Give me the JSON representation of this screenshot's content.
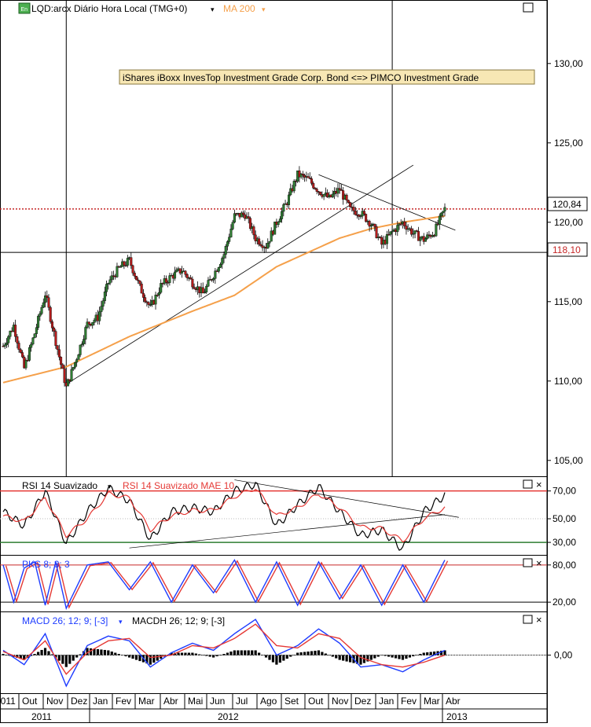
{
  "header": {
    "symbol_label": "LQD:arcx Diário Hora Local (TMG+0)",
    "ma_label": "MA 200",
    "annotation": "iShares iBoxx InvesTop Investment Grade Corp. Bond  <=> PIMCO Investment Grade",
    "price_tag_last": "120,84",
    "price_tag_line": "118,10"
  },
  "panels": {
    "rsi": {
      "label": "RSI 14 Suavizado",
      "label2": "RSI 14 Suavizado MAE 10"
    },
    "pks": {
      "label": "PKS 8; 3; 3"
    },
    "macd": {
      "label": "MACD 26; 12; 9; [-3]",
      "label2": "MACDH 26; 12; 9; [-3]"
    }
  },
  "colors": {
    "price_up": "#2e7d32",
    "price_down": "#b71c1c",
    "ma": "#f5a04a",
    "rsi_line": "#000000",
    "rsi_signal": "#e53935",
    "overbought": "#e53935",
    "oversold": "#2e7d32",
    "pks_fast": "#1e3cff",
    "pks_slow": "#e53935",
    "macd": "#1e3cff",
    "signal": "#e53935",
    "hist": "#000000",
    "tag_bg": "#ffffff"
  },
  "chart_data": [
    {
      "type": "candlestick",
      "title": "LQD:arcx Diário Hora Local (TMG+0)",
      "ylim": [
        104,
        134
      ],
      "y_ticks": [
        "130,00",
        "125,00",
        "120,00",
        "115,00",
        "110,00",
        "105,00"
      ],
      "x_ticks": [
        "2011",
        "Out",
        "Nov",
        "Dez",
        "Jan",
        "Fev",
        "Mar",
        "Abr",
        "Mai",
        "Jun",
        "Jul",
        "Ago",
        "Set",
        "Out",
        "Nov",
        "Dez",
        "Jan",
        "Fev",
        "Mar",
        "Abr"
      ],
      "year_labels": [
        "2011",
        "2012",
        "2013"
      ],
      "close_path": [
        [
          0,
          112.2
        ],
        [
          3,
          113.5
        ],
        [
          6,
          110.8
        ],
        [
          9,
          113.0
        ],
        [
          12,
          115.5
        ],
        [
          15,
          112.5
        ],
        [
          18,
          109.6
        ],
        [
          21,
          111.5
        ],
        [
          24,
          113.6
        ],
        [
          27,
          114.0
        ],
        [
          30,
          116.2
        ],
        [
          33,
          117.1
        ],
        [
          36,
          117.6
        ],
        [
          39,
          115.9
        ],
        [
          42,
          114.6
        ],
        [
          45,
          116.0
        ],
        [
          48,
          116.6
        ],
        [
          51,
          117.0
        ],
        [
          54,
          116.2
        ],
        [
          57,
          115.5
        ],
        [
          60,
          116.7
        ],
        [
          63,
          118.0
        ],
        [
          66,
          120.4
        ],
        [
          69,
          120.5
        ],
        [
          72,
          119.0
        ],
        [
          75,
          118.5
        ],
        [
          78,
          120.0
        ],
        [
          81,
          121.3
        ],
        [
          84,
          123.0
        ],
        [
          87,
          122.7
        ],
        [
          90,
          122.0
        ],
        [
          93,
          121.5
        ],
        [
          96,
          122.1
        ],
        [
          99,
          120.8
        ],
        [
          102,
          120.6
        ],
        [
          105,
          119.9
        ],
        [
          108,
          118.6
        ],
        [
          111,
          119.4
        ],
        [
          114,
          120.0
        ],
        [
          117,
          119.3
        ],
        [
          120,
          118.9
        ],
        [
          123,
          119.4
        ],
        [
          126,
          120.84
        ]
      ],
      "ma200_path": [
        [
          0,
          109.9
        ],
        [
          18,
          110.9
        ],
        [
          36,
          112.8
        ],
        [
          54,
          114.4
        ],
        [
          66,
          115.4
        ],
        [
          78,
          117.2
        ],
        [
          96,
          119.0
        ],
        [
          105,
          119.6
        ],
        [
          114,
          120.0
        ],
        [
          126,
          120.4
        ]
      ],
      "horizontal_levels": [
        120.84,
        118.1
      ],
      "trendlines": [
        {
          "from": [
            18,
            109.8
          ],
          "to": [
            117,
            123.6
          ]
        },
        {
          "from": [
            90,
            123.0
          ],
          "to": [
            129,
            119.5
          ]
        }
      ],
      "vertical_markers": [
        18,
        111
      ]
    },
    {
      "type": "line",
      "title": "RSI 14 Suavizado",
      "ylim": [
        24,
        80
      ],
      "y_ticks": [
        "70,00",
        "50,00",
        "30,00"
      ],
      "levels": {
        "overbought": 70,
        "mid": 50,
        "oversold": 33
      },
      "series": [
        {
          "name": "RSI 14 Suavizado",
          "values": [
            [
              0,
              55
            ],
            [
              6,
              45
            ],
            [
              12,
              70
            ],
            [
              18,
              32
            ],
            [
              24,
              55
            ],
            [
              30,
              72
            ],
            [
              36,
              63
            ],
            [
              42,
              35
            ],
            [
              48,
              55
            ],
            [
              54,
              58
            ],
            [
              60,
              55
            ],
            [
              66,
              70
            ],
            [
              72,
              75
            ],
            [
              78,
              45
            ],
            [
              84,
              60
            ],
            [
              90,
              73
            ],
            [
              96,
              55
            ],
            [
              102,
              38
            ],
            [
              108,
              42
            ],
            [
              114,
              28
            ],
            [
              120,
              55
            ],
            [
              126,
              67
            ]
          ]
        },
        {
          "name": "RSI 14 Suavizado MAE 10",
          "values": [
            [
              0,
              52
            ],
            [
              6,
              48
            ],
            [
              12,
              65
            ],
            [
              18,
              38
            ],
            [
              24,
              50
            ],
            [
              30,
              68
            ],
            [
              36,
              65
            ],
            [
              42,
              42
            ],
            [
              48,
              52
            ],
            [
              54,
              56
            ],
            [
              60,
              56
            ],
            [
              66,
              66
            ],
            [
              72,
              72
            ],
            [
              78,
              52
            ],
            [
              84,
              58
            ],
            [
              90,
              68
            ],
            [
              96,
              58
            ],
            [
              102,
              44
            ],
            [
              108,
              43
            ],
            [
              114,
              34
            ],
            [
              120,
              50
            ],
            [
              126,
              58
            ]
          ]
        }
      ]
    },
    {
      "type": "line",
      "title": "PKS 8; 3; 3",
      "ylim": [
        5,
        95
      ],
      "y_ticks": [
        "80,00",
        "20,00"
      ],
      "series": [
        {
          "name": "PKS 8; 3; 3",
          "values": [
            [
              0,
              80
            ],
            [
              3,
              20
            ],
            [
              6,
              75
            ],
            [
              9,
              85
            ],
            [
              12,
              15
            ],
            [
              15,
              85
            ],
            [
              18,
              10
            ],
            [
              24,
              80
            ],
            [
              30,
              85
            ],
            [
              36,
              40
            ],
            [
              42,
              85
            ],
            [
              48,
              20
            ],
            [
              54,
              80
            ],
            [
              60,
              35
            ],
            [
              66,
              88
            ],
            [
              72,
              20
            ],
            [
              78,
              85
            ],
            [
              84,
              15
            ],
            [
              90,
              85
            ],
            [
              96,
              25
            ],
            [
              102,
              80
            ],
            [
              108,
              15
            ],
            [
              114,
              80
            ],
            [
              120,
              20
            ],
            [
              126,
              88
            ]
          ]
        }
      ]
    },
    {
      "type": "line",
      "title": "MACD 26; 12; 9; [-3]",
      "ylim": [
        -1.6,
        1.8
      ],
      "y_ticks": [
        "0,00"
      ],
      "series": [
        {
          "name": "MACD 26; 12; 9; [-3]",
          "values": [
            [
              0,
              0.2
            ],
            [
              6,
              -0.4
            ],
            [
              12,
              0.9
            ],
            [
              18,
              -1.3
            ],
            [
              24,
              0.4
            ],
            [
              30,
              0.8
            ],
            [
              36,
              0.6
            ],
            [
              42,
              -0.5
            ],
            [
              48,
              0.1
            ],
            [
              54,
              0.5
            ],
            [
              60,
              0.2
            ],
            [
              66,
              0.9
            ],
            [
              72,
              1.5
            ],
            [
              78,
              0.0
            ],
            [
              84,
              0.4
            ],
            [
              90,
              1.1
            ],
            [
              96,
              0.5
            ],
            [
              102,
              -0.5
            ],
            [
              108,
              -0.4
            ],
            [
              114,
              -0.7
            ],
            [
              120,
              -0.2
            ],
            [
              126,
              0.2
            ]
          ]
        },
        {
          "name": "Signal",
          "values": [
            [
              0,
              0.15
            ],
            [
              6,
              -0.2
            ],
            [
              12,
              0.6
            ],
            [
              18,
              -0.8
            ],
            [
              24,
              0.1
            ],
            [
              30,
              0.6
            ],
            [
              36,
              0.7
            ],
            [
              42,
              -0.1
            ],
            [
              48,
              0.0
            ],
            [
              54,
              0.4
            ],
            [
              60,
              0.3
            ],
            [
              66,
              0.7
            ],
            [
              72,
              1.3
            ],
            [
              78,
              0.4
            ],
            [
              84,
              0.3
            ],
            [
              90,
              0.9
            ],
            [
              96,
              0.7
            ],
            [
              102,
              -0.1
            ],
            [
              108,
              -0.4
            ],
            [
              114,
              -0.5
            ],
            [
              120,
              -0.3
            ],
            [
              126,
              0.0
            ]
          ]
        }
      ],
      "histogram": [
        [
          0,
          0.05
        ],
        [
          6,
          -0.2
        ],
        [
          12,
          0.3
        ],
        [
          18,
          -0.5
        ],
        [
          24,
          0.3
        ],
        [
          30,
          0.2
        ],
        [
          36,
          -0.1
        ],
        [
          42,
          -0.4
        ],
        [
          48,
          0.1
        ],
        [
          54,
          0.1
        ],
        [
          60,
          -0.1
        ],
        [
          66,
          0.2
        ],
        [
          72,
          0.2
        ],
        [
          78,
          -0.4
        ],
        [
          84,
          0.1
        ],
        [
          90,
          0.2
        ],
        [
          96,
          -0.2
        ],
        [
          102,
          -0.4
        ],
        [
          108,
          0.0
        ],
        [
          114,
          -0.2
        ],
        [
          120,
          0.1
        ],
        [
          126,
          0.2
        ]
      ]
    }
  ]
}
